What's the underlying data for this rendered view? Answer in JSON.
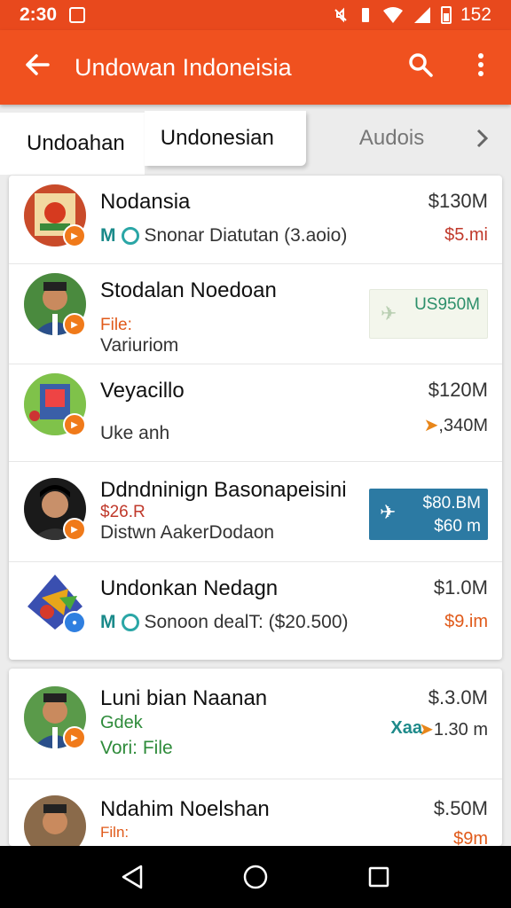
{
  "status_bar": {
    "time": "2:30",
    "battery_text": "152"
  },
  "app_bar": {
    "title": "Undowan Indoneisia"
  },
  "tabs": [
    {
      "label": "Undoahan"
    },
    {
      "label": "Undonesian"
    },
    {
      "label": "Audois"
    }
  ],
  "rows": [
    {
      "name": "Nodansia",
      "meta": "Snonar Diatutan (3.aoio)",
      "meta_prefix": "M",
      "price": "$130M",
      "price2": "$5.mi"
    },
    {
      "name": "Stodalan Noedoan",
      "line1": "File:",
      "line2": "Variuriom",
      "price": "US950M"
    },
    {
      "name": "Veyacillo",
      "line2": "Uke anh",
      "price": "$120M",
      "price2": ",340M"
    },
    {
      "name": "Ddndninign Basonapeisini",
      "line1": "$26.R",
      "line2": "Distwn AakerDodaon",
      "price": "$80.BM",
      "price2": "$60 m"
    },
    {
      "name": "Undonkan Nedagn",
      "meta": "Sonoon dealT: ($20.500)",
      "meta_prefix": "M",
      "price": "$1.0M",
      "price2": "$9.im"
    },
    {
      "name": "Luni bian Naanan",
      "line1": "Gdek",
      "line2": "Vori: File",
      "price": "$.3.0M",
      "price2": "1.30 m",
      "mark": "Xaa"
    },
    {
      "name": "Ndahim Noelshan",
      "line1": "Filn:",
      "price": "$.50M",
      "price2": "$9m"
    }
  ]
}
